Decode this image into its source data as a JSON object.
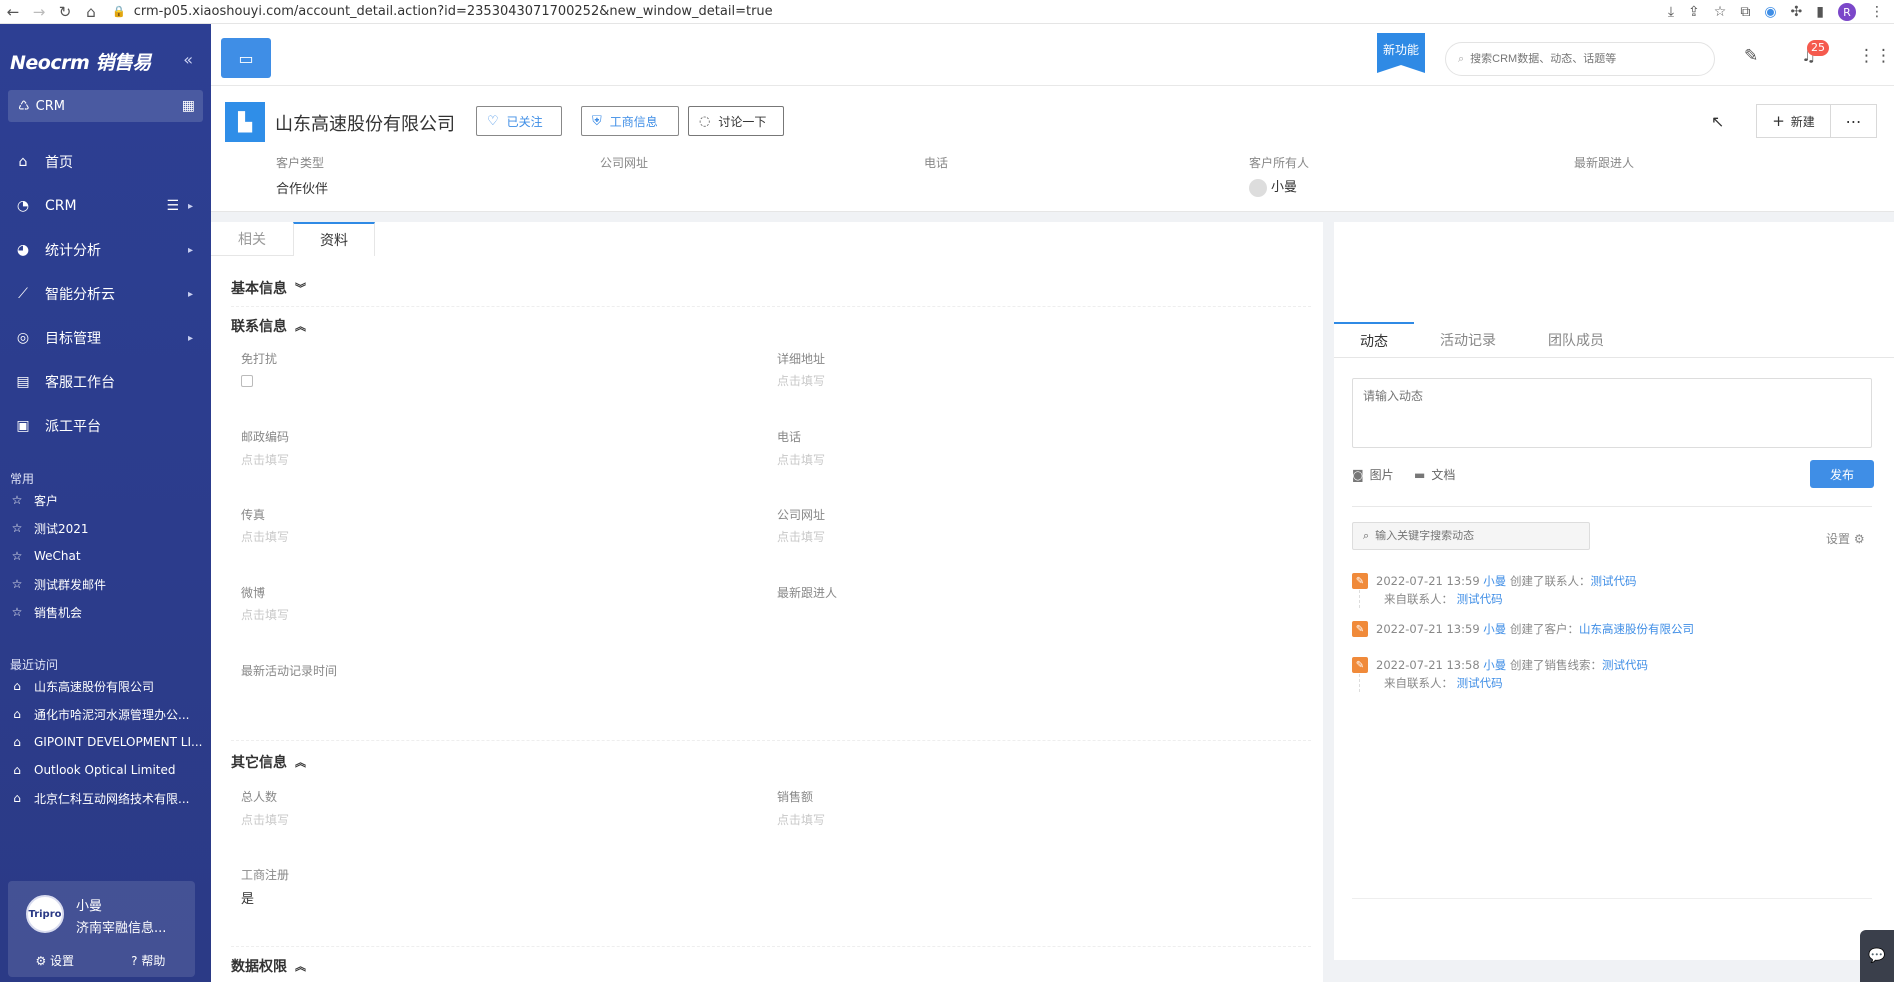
{
  "browser": {
    "url": "crm-p05.xiaoshouyi.com/account_detail.action?id=2353043071700252&new_window_detail=true",
    "profile_initial": "R"
  },
  "sidebar": {
    "logo": "Neocrm 销售易",
    "app_switch": "CRM",
    "nav": [
      {
        "label": "首页"
      },
      {
        "label": "CRM"
      },
      {
        "label": "统计分析"
      },
      {
        "label": "智能分析云"
      },
      {
        "label": "目标管理"
      },
      {
        "label": "客服工作台"
      },
      {
        "label": "派工平台"
      }
    ],
    "common_title": "常用",
    "common": [
      "客户",
      "测试2021",
      "WeChat",
      "测试群发邮件",
      "销售机会"
    ],
    "recent_title": "最近访问",
    "recent": [
      "山东高速股份有限公司",
      "通化市哈泥河水源管理办公...",
      "GIPOINT DEVELOPMENT LI...",
      "Outlook Optical Limited",
      "北京仁科互动网络技术有限..."
    ],
    "user": {
      "name": "小曼",
      "company": "济南宰融信息...",
      "avatar_text": "Tripro",
      "settings": "设置",
      "help": "帮助"
    }
  },
  "topbar": {
    "new_feature": "新功能",
    "search_placeholder": "搜索CRM数据、动态、话题等",
    "notifications": "25"
  },
  "account": {
    "name": "山东高速股份有限公司",
    "follow": "已关注",
    "business_info": "工商信息",
    "discuss": "讨论一下",
    "new_button": "新建",
    "fields": [
      {
        "label": "客户类型",
        "value": "合作伙伴"
      },
      {
        "label": "公司网址",
        "value": ""
      },
      {
        "label": "电话",
        "value": ""
      },
      {
        "label": "客户所有人",
        "value": "小曼"
      },
      {
        "label": "最新跟进人",
        "value": ""
      }
    ]
  },
  "detail": {
    "tabs": [
      "相关",
      "资料"
    ],
    "active_tab": "资料",
    "placeholder": "点击填写",
    "groups": {
      "basic": "基本信息",
      "contact": "联系信息",
      "other": "其它信息",
      "permission": "数据权限"
    },
    "contact_fields": {
      "dnd": "免打扰",
      "address": "详细地址",
      "zip": "邮政编码",
      "phone": "电话",
      "fax": "传真",
      "website": "公司网址",
      "weibo": "微博",
      "latest_follower": "最新跟进人",
      "latest_activity_time": "最新活动记录时间"
    },
    "other_fields": {
      "headcount": "总人数",
      "sales": "销售额",
      "registered": "工商注册",
      "registered_value": "是"
    }
  },
  "right": {
    "tabs": [
      "动态",
      "活动记录",
      "团队成员"
    ],
    "active_tab": "动态",
    "post_placeholder": "请输入动态",
    "image": "图片",
    "doc": "文档",
    "publish": "发布",
    "search_placeholder": "输入关键字搜索动态",
    "settings": "设置",
    "feed": [
      {
        "time": "2022-07-21 13:59",
        "user": "小曼",
        "action": "创建了联系人：",
        "target": "测试代码",
        "sub_label": "来自联系人：",
        "sub_target": "测试代码"
      },
      {
        "time": "2022-07-21 13:59",
        "user": "小曼",
        "action": "创建了客户：",
        "target": "山东高速股份有限公司",
        "sub_label": "",
        "sub_target": ""
      },
      {
        "time": "2022-07-21 13:58",
        "user": "小曼",
        "action": "创建了销售线索：",
        "target": "测试代码",
        "sub_label": "来自联系人：",
        "sub_target": "测试代码"
      }
    ]
  }
}
